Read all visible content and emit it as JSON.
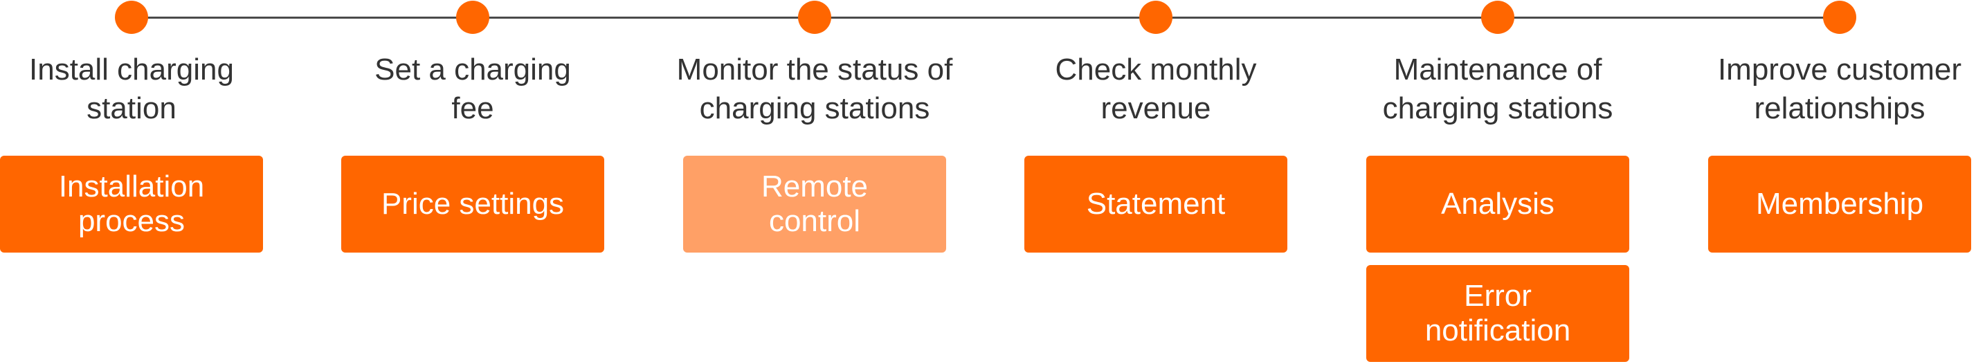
{
  "colors": {
    "dot": "#FF6600",
    "card": "#FF6600",
    "card_dim": "#FFA066",
    "line": "#4A4A4A"
  },
  "steps": [
    {
      "title": "Install charging\nstation",
      "cards": [
        {
          "label": "Installation\nprocess"
        }
      ]
    },
    {
      "title": "Set a charging\nfee",
      "cards": [
        {
          "label": "Price settings"
        }
      ]
    },
    {
      "title": "Monitor the status of\ncharging stations",
      "cards": [
        {
          "label": "Remote\ncontrol",
          "dim": true
        }
      ]
    },
    {
      "title": "Check monthly\nrevenue",
      "cards": [
        {
          "label": "Statement"
        }
      ]
    },
    {
      "title": "Maintenance of\ncharging stations",
      "cards": [
        {
          "label": "Analysis"
        },
        {
          "label": "Error\nnotification"
        }
      ]
    },
    {
      "title": "Improve customer\nrelationships",
      "cards": [
        {
          "label": "Membership"
        }
      ]
    }
  ]
}
